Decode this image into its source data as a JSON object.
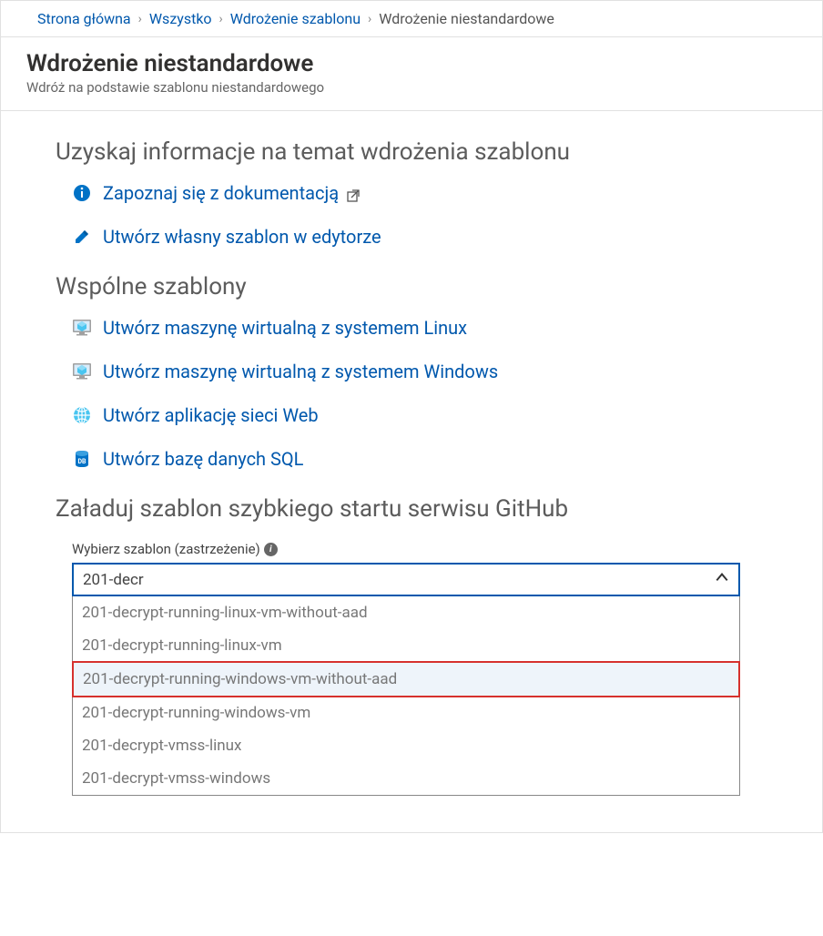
{
  "breadcrumb": {
    "home": "Strona główna",
    "all": "Wszystko",
    "template_deploy": "Wdrożenie szablonu",
    "current": "Wdrożenie niestandardowe"
  },
  "header": {
    "title": "Wdrożenie niestandardowe",
    "subtitle": "Wdróż na podstawie szablonu niestandardowego"
  },
  "sections": {
    "learn": "Uzyskaj informacje na temat wdrożenia szablonu",
    "common": "Wspólne szablony",
    "github": "Załaduj szablon szybkiego startu serwisu GitHub"
  },
  "links": {
    "docs": "Zapoznaj się z dokumentacją",
    "editor": "Utwórz własny szablon w edytorze",
    "linux_vm": "Utwórz maszynę wirtualną z systemem Linux",
    "windows_vm": "Utwórz maszynę wirtualną z systemem Windows",
    "webapp": "Utwórz aplikację sieci Web",
    "sqldb": "Utwórz bazę danych SQL"
  },
  "template_selector": {
    "label": "Wybierz szablon (zastrzeżenie)",
    "value": "201-decr",
    "options": [
      "201-decrypt-running-linux-vm-without-aad",
      "201-decrypt-running-linux-vm",
      "201-decrypt-running-windows-vm-without-aad",
      "201-decrypt-running-windows-vm",
      "201-decrypt-vmss-linux",
      "201-decrypt-vmss-windows"
    ],
    "highlighted_index": 2
  }
}
